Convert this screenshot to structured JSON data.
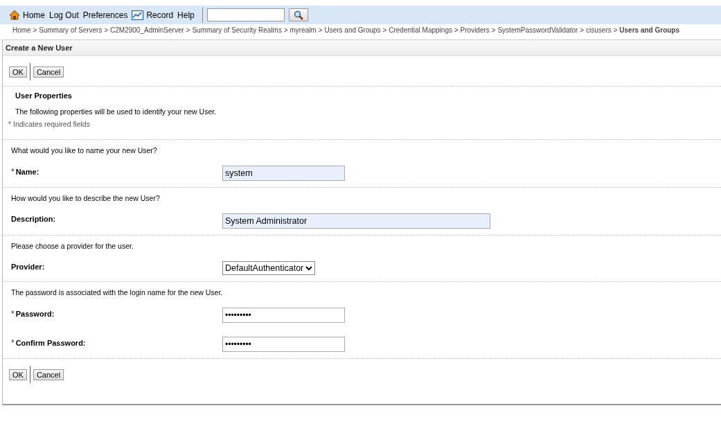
{
  "toolbar": {
    "items": [
      {
        "kind": "home",
        "label": "Home"
      },
      {
        "kind": "link",
        "label": "Log Out"
      },
      {
        "kind": "link",
        "label": "Preferences"
      },
      {
        "kind": "record",
        "label": "Record"
      },
      {
        "kind": "link",
        "label": "Help"
      }
    ]
  },
  "breadcrumbs": [
    {
      "label": "Home >",
      "current": false
    },
    {
      "label": "Summary of Servers >",
      "current": false
    },
    {
      "label": "C2M2900_AdminServer >",
      "current": false
    },
    {
      "label": "Summary of Security Realms >",
      "current": false
    },
    {
      "label": "myrealm >",
      "current": false
    },
    {
      "label": "Users and Groups >",
      "current": false
    },
    {
      "label": "Credential Mappings >",
      "current": false
    },
    {
      "label": "Providers >",
      "current": false
    },
    {
      "label": "SystemPasswordValidator >",
      "current": false
    },
    {
      "label": "cisusers >",
      "current": false
    },
    {
      "label": "Users and Groups",
      "current": true
    }
  ],
  "panel": {
    "title": "Create a New User",
    "top_buttons": [
      "OK",
      "Cancel"
    ],
    "heading": "User Properties",
    "intro": "The following properties will be used to identify your new User.",
    "required_note": "* Indicates required fields",
    "sections": [
      {
        "question": "What would you like to name your new User?",
        "fields": [
          {
            "label": "Name:",
            "marker": "*",
            "kind": "text",
            "value": "system"
          }
        ]
      },
      {
        "question": "How would you like to describe the new User?",
        "fields": [
          {
            "label": "Description:",
            "kind": "wide-text",
            "value": "System Administrator"
          }
        ]
      },
      {
        "question": "Please choose a provider for the user.",
        "fields": [
          {
            "label": "Provider:",
            "kind": "select",
            "value": "DefaultAuthenticator"
          }
        ]
      },
      {
        "question": "The password is associated with the login name for the new User.",
        "fields": [
          {
            "label": "Password:",
            "marker": "*",
            "kind": "password",
            "value": "•••••••••"
          },
          {
            "label": "Confirm Password:",
            "marker": "*",
            "kind": "password",
            "value": "•••••••••"
          }
        ]
      }
    ],
    "bottom_buttons": [
      "OK",
      "Cancel"
    ]
  }
}
